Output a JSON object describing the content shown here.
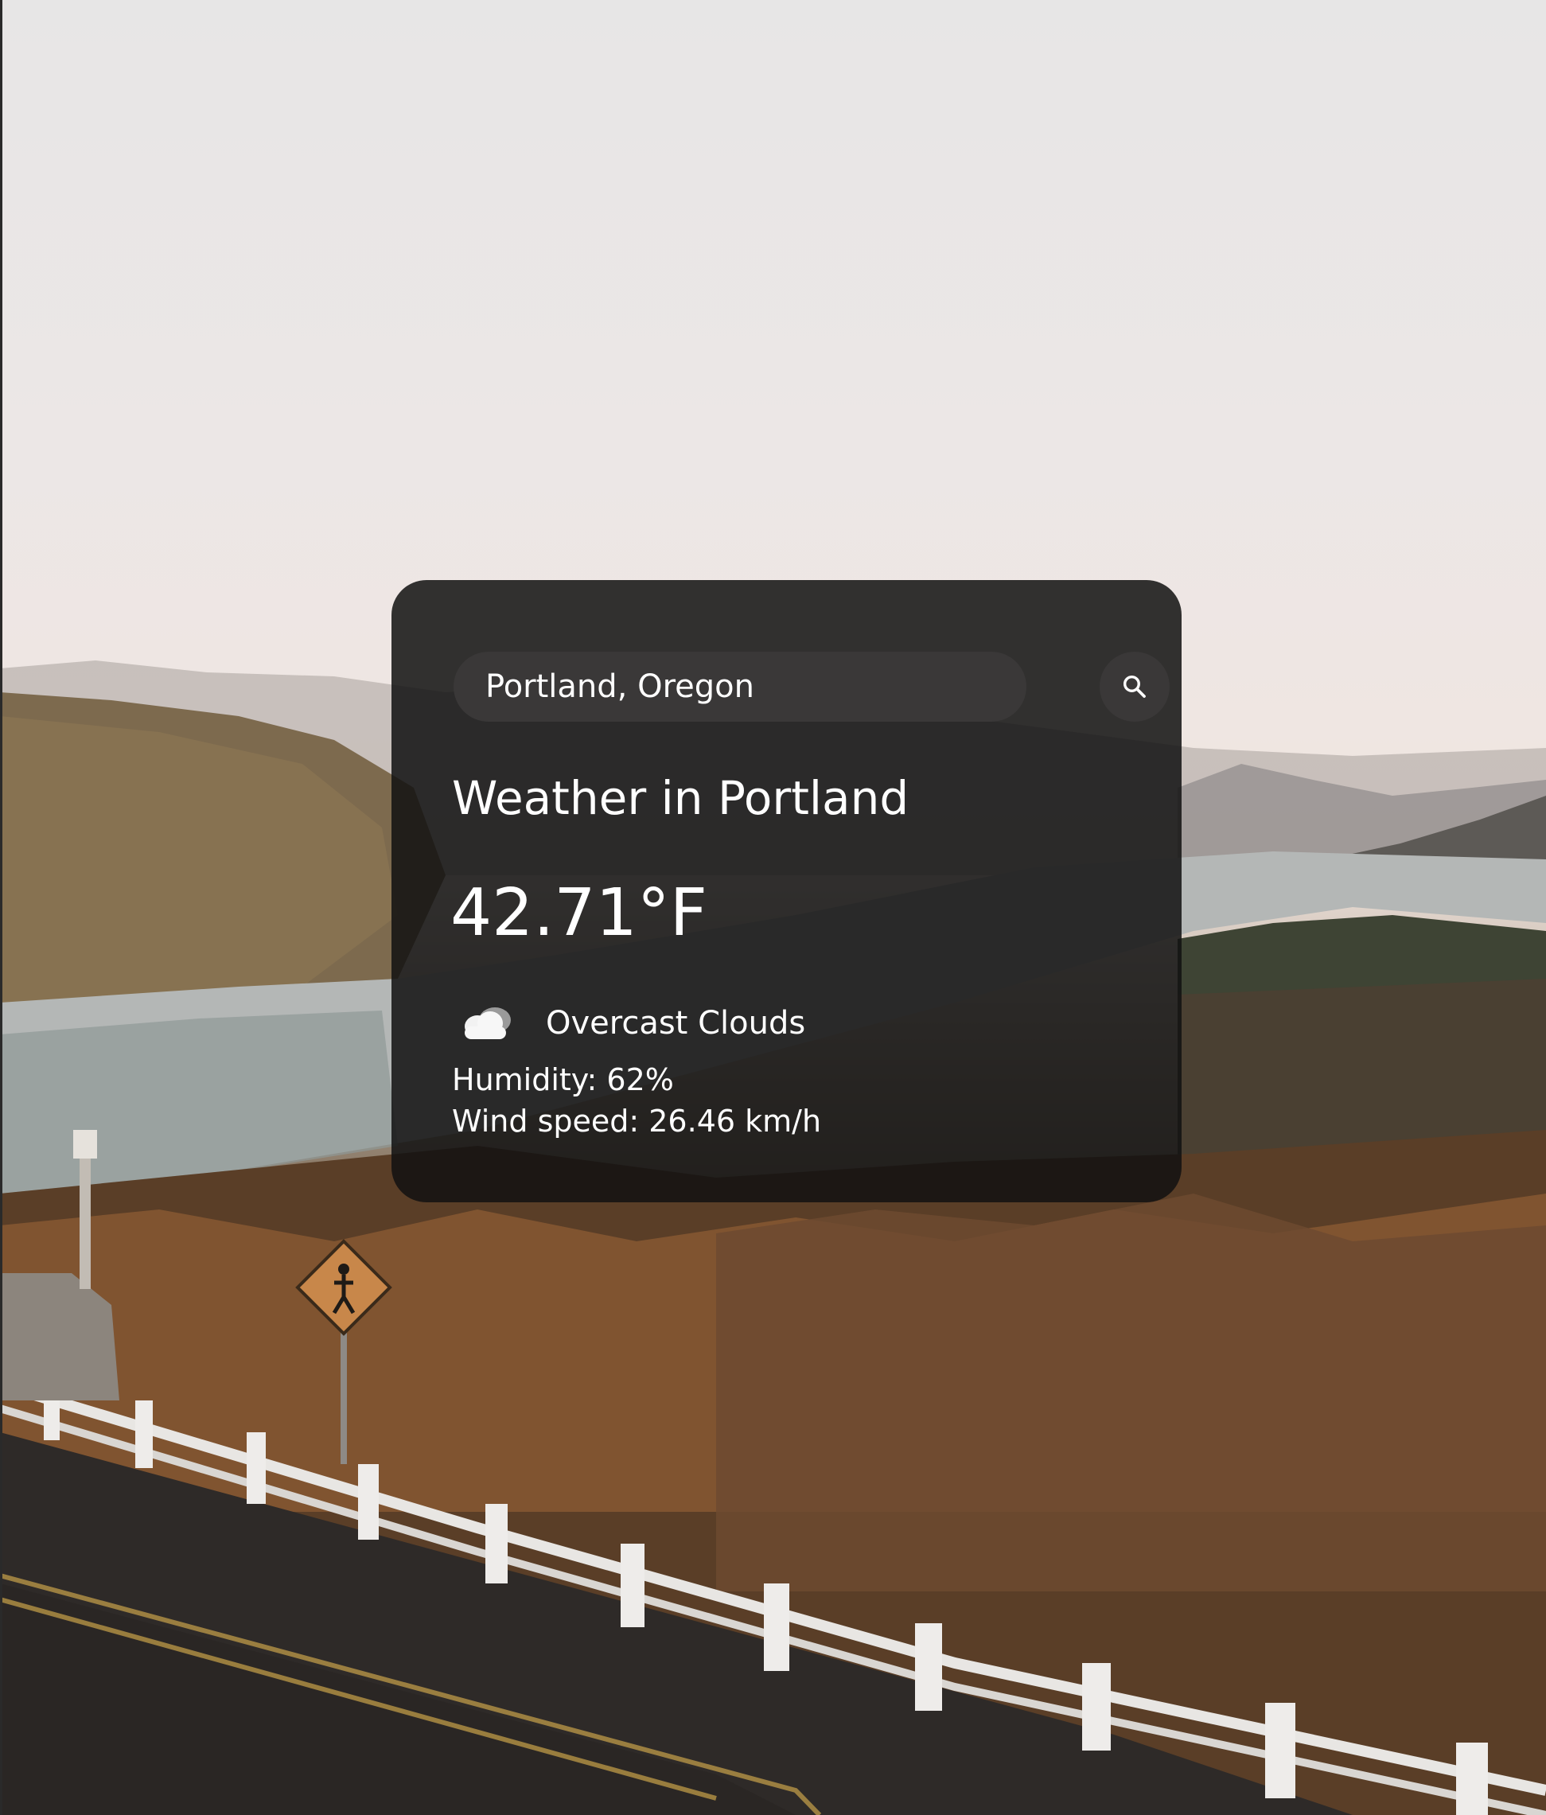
{
  "search": {
    "value": "Portland, Oregon",
    "button_icon": "search-icon"
  },
  "weather": {
    "title": "Weather in Portland",
    "temperature": "42.71°F",
    "condition_icon": "cloud-icon",
    "condition": "Overcast Clouds",
    "humidity": "Humidity: 62%",
    "wind": "Wind speed: 26.46 km/h"
  },
  "colors": {
    "card_background": "#121212",
    "input_background": "#3a3838",
    "text": "#ffffff"
  }
}
